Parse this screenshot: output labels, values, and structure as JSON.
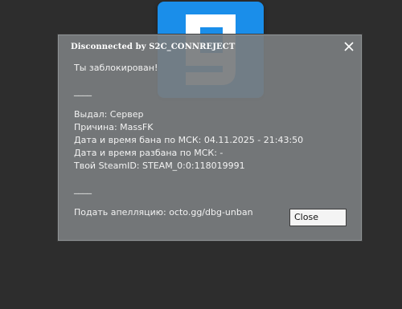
{
  "dialog": {
    "title": "Disconnected by S2C_CONNREJECT",
    "lines": [
      "Ты заблокирован!",
      "____",
      "Выдал: Сервер",
      "Причина: MassFK",
      "Дата и время бана по МСК: 04.11.2025 - 21:43:50",
      "Дата и время разбана по МСК: -",
      "Твой SteamID: STEAM_0:0:118019991",
      "____",
      "Подать апелляцию: octo.gg/dbg-unban"
    ],
    "close_button_label": "Close"
  },
  "icons": {
    "close": "close-icon",
    "logo": "logo-icon"
  },
  "colors": {
    "background": "#2d2d2d",
    "dialog": "#787c7e",
    "logo_tile": "#1a8eea",
    "text": "#f2f2f2"
  }
}
